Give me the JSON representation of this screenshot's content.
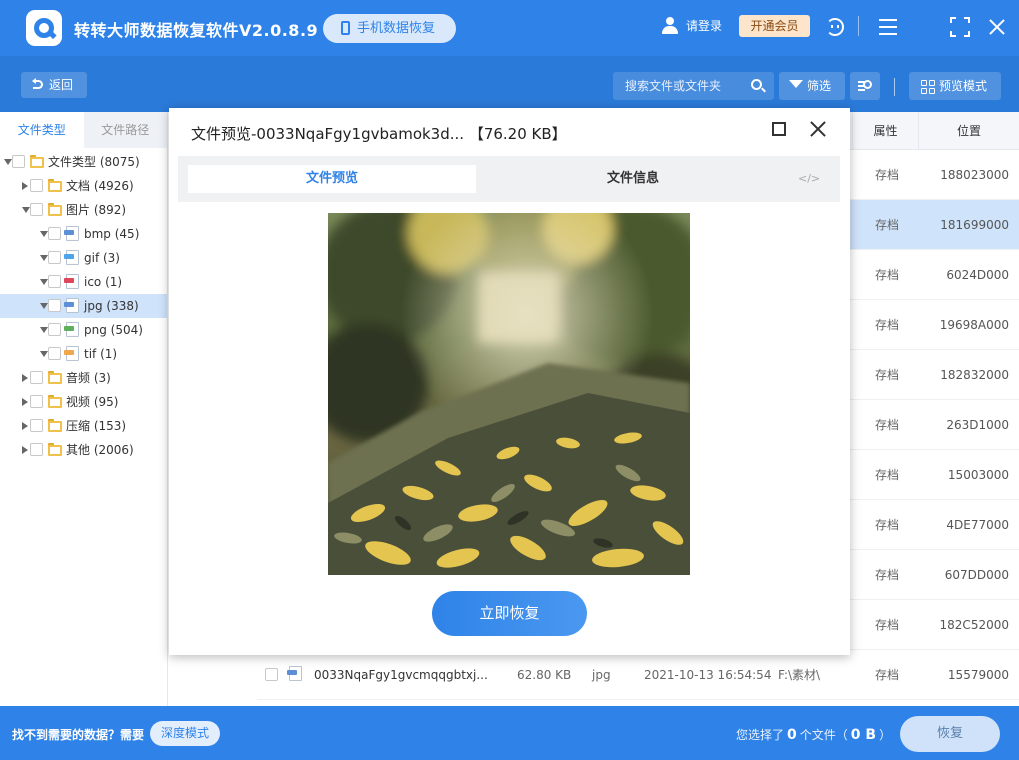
{
  "app": {
    "title": "转转大师数据恢复软件V2.0.8.9",
    "mobile_button": "手机数据恢复",
    "login": "请登录",
    "vip": "开通会员"
  },
  "toolbar": {
    "back": "返回",
    "search_placeholder": "搜索文件或文件夹",
    "filter": "筛选",
    "preview_mode": "预览模式"
  },
  "sidebar": {
    "tabs": [
      "文件类型",
      "文件路径"
    ],
    "tree": [
      {
        "label": "文件类型 (8075)",
        "level": 0,
        "state": "open",
        "icon": "folder-icon"
      },
      {
        "label": "文档 (4926)",
        "level": 1,
        "state": "closed",
        "icon": "folder-icon"
      },
      {
        "label": "图片 (892)",
        "level": 1,
        "state": "open",
        "icon": "folder-icon"
      },
      {
        "label": "bmp (45)",
        "level": 2,
        "state": "open",
        "icon": "bmp-file-icon",
        "tag": "#5d8fd6"
      },
      {
        "label": "gif (3)",
        "level": 2,
        "state": "open",
        "icon": "gif-file-icon",
        "tag": "#4fa3e8"
      },
      {
        "label": "ico (1)",
        "level": 2,
        "state": "open",
        "icon": "ico-file-icon",
        "tag": "#e0455a"
      },
      {
        "label": "jpg (338)",
        "level": 2,
        "state": "open",
        "icon": "jpg-file-icon",
        "tag": "#5d8fd6",
        "selected": true
      },
      {
        "label": "png (504)",
        "level": 2,
        "state": "open",
        "icon": "png-file-icon",
        "tag": "#5fb05c"
      },
      {
        "label": "tif (1)",
        "level": 2,
        "state": "open",
        "icon": "tif-file-icon",
        "tag": "#f0a64a"
      },
      {
        "label": "音频 (3)",
        "level": 1,
        "state": "closed",
        "icon": "folder-icon"
      },
      {
        "label": "视频 (95)",
        "level": 1,
        "state": "closed",
        "icon": "folder-icon"
      },
      {
        "label": "压缩 (153)",
        "level": 1,
        "state": "closed",
        "icon": "folder-icon"
      },
      {
        "label": "其他 (2006)",
        "level": 1,
        "state": "closed",
        "icon": "folder-icon"
      }
    ]
  },
  "table": {
    "headers": {
      "attr": "属性",
      "pos": "位置"
    },
    "rows": [
      {
        "attr": "存档",
        "pos": "188023000"
      },
      {
        "attr": "存档",
        "pos": "181699000",
        "highlight": true
      },
      {
        "attr": "存档",
        "pos": "6024D000"
      },
      {
        "attr": "存档",
        "pos": "19698A000"
      },
      {
        "attr": "存档",
        "pos": "182832000"
      },
      {
        "attr": "存档",
        "pos": "263D1000"
      },
      {
        "attr": "存档",
        "pos": "15003000"
      },
      {
        "attr": "存档",
        "pos": "4DE77000"
      },
      {
        "attr": "存档",
        "pos": "607DD000"
      },
      {
        "attr": "存档",
        "pos": "182C52000"
      },
      {
        "attr": "存档",
        "pos": "15579000",
        "name": "0033NqaFgy1gvcmqqgbtxj...",
        "size": "62.80 KB",
        "type": "jpg",
        "date": "2021-10-13 16:54:54",
        "path": "F:\\素材\\"
      }
    ]
  },
  "modal": {
    "title": "文件预览-0033NqaFgy1gvbamok3d... 【76.20 KB】",
    "tab_preview": "文件预览",
    "tab_info": "文件信息",
    "code_tab": "</>",
    "recover_button": "立即恢复"
  },
  "bottom": {
    "not_found": "找不到需要的数据？需要",
    "deep_mode": "深度模式",
    "selected_prefix": "您选择了",
    "selected_count": "0",
    "selected_mid": "个文件（",
    "selected_size": "0 B",
    "selected_suffix": "）",
    "recover": "恢复"
  },
  "colors": {
    "primary": "#2f83e8",
    "selected_row": "#cfe3fb"
  }
}
